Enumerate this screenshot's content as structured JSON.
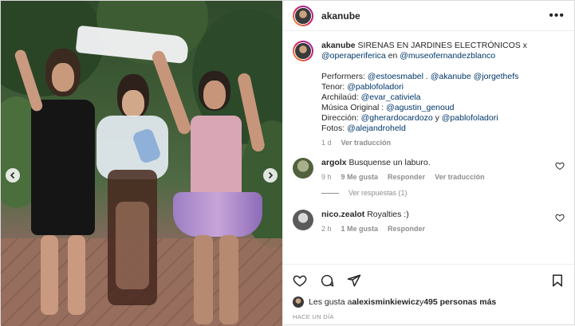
{
  "post": {
    "username": "akanube",
    "caption": {
      "username": "akanube",
      "title": "SIRENAS EN JARDINES ELECTRÓNICOS x",
      "line2_mention": "@operaperiferica",
      "line2_mid": " en ",
      "line2_mention2": "@museofernandezblanco",
      "performers_label": "Performers: ",
      "performers": [
        "@estoesmabel",
        "@akanube",
        "@jorgethefs"
      ],
      "tenor_label": "Tenor: ",
      "tenor": "@pablofoladori",
      "archilaud_label": "Archilaúd: ",
      "archilaud": "@evar_cativiela",
      "musica_label": "Música Original : ",
      "musica": "@agustin_genoud",
      "direccion_label": "Dirección: ",
      "direccion1": "@gherardocardozo",
      "direccion_and": " y ",
      "direccion2": "@pablofoladori",
      "fotos_label": "Fotos: ",
      "fotos": "@alejandroheld"
    },
    "caption_meta": {
      "age": "1 d",
      "translate": "Ver traducción"
    },
    "comments": [
      {
        "username": "argolx",
        "text": "Busquense un laburo.",
        "age": "9 h",
        "likes": "9 Me gusta",
        "reply": "Responder",
        "translate": "Ver traducción",
        "replies": "Ver respuestas (1)"
      },
      {
        "username": "nico.zealot",
        "text": "Royalties :)",
        "age": "2 h",
        "likes": "1 Me gusta",
        "reply": "Responder"
      }
    ],
    "likes": {
      "prefix": "Les gusta a ",
      "user": "alexisminkiewicz",
      "mid": " y ",
      "count": "495 personas más"
    },
    "timestamp": "HACE UN DÍA",
    "colors": {
      "link": "#00376b",
      "muted": "#8e8e8e",
      "text": "#262626"
    }
  }
}
